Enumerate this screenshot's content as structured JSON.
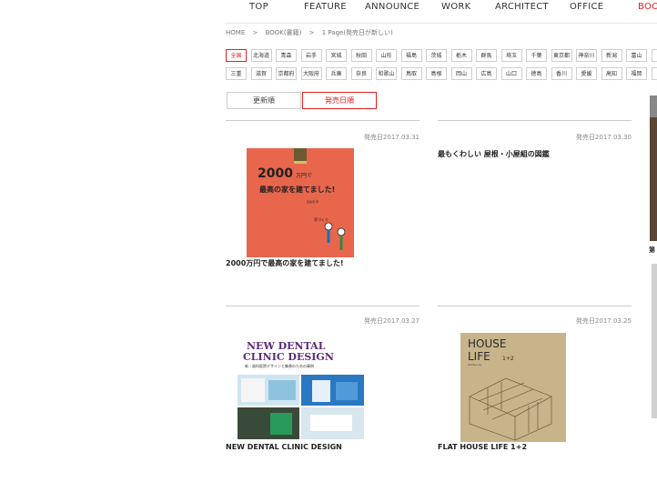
{
  "nav": [
    {
      "label": "TOP"
    },
    {
      "label": "FEATURE"
    },
    {
      "label": "ANNOUNCE"
    },
    {
      "label": "WORK"
    },
    {
      "label": "ARCHITECT"
    },
    {
      "label": "OFFICE"
    },
    {
      "label": "BOO",
      "color": "#d22"
    }
  ],
  "breadcrumb": [
    "HOME",
    ">",
    "BOOK(書籍)",
    ">",
    "1 Page(発売日が新しい)"
  ],
  "prefectures": [
    [
      "全国",
      "北海道",
      "青森",
      "岩手",
      "宮城",
      "秋田",
      "山形",
      "福島",
      "茨城",
      "栃木",
      "群馬",
      "埼玉",
      "千葉",
      "東京都",
      "神奈川",
      "新潟",
      "富山",
      "石"
    ],
    [
      "三重",
      "滋賀",
      "京都府",
      "大阪府",
      "兵庫",
      "奈良",
      "和歌山",
      "鳥取",
      "島根",
      "岡山",
      "広島",
      "山口",
      "徳島",
      "香川",
      "愛媛",
      "高知",
      "福岡",
      "佐"
    ]
  ],
  "sort": [
    {
      "label": "更新順",
      "active": false
    },
    {
      "label": "発売日順",
      "active": true
    }
  ],
  "books": [
    {
      "date": "発売日2017.03.31",
      "title": "2000万円で最高の家を建てました!",
      "cover": "2000万円で 最高の家 を建てました!"
    },
    {
      "date": "発売日2017.03.30",
      "title": "最もくわしい 屋根・小屋組の図鑑",
      "cover": ""
    },
    {
      "date": "発売日2017.03.27",
      "title": "NEW DENTAL CLINIC DESIGN",
      "cover": "NEW DENTAL CLINIC DESIGN"
    },
    {
      "date": "発売日2017.03.25",
      "title": "FLAT HOUSE LIFE 1+2",
      "cover": "HOUSE LIFE 1+2"
    }
  ],
  "side": {
    "label": "第"
  },
  "colors": {
    "accent": "#d22"
  }
}
